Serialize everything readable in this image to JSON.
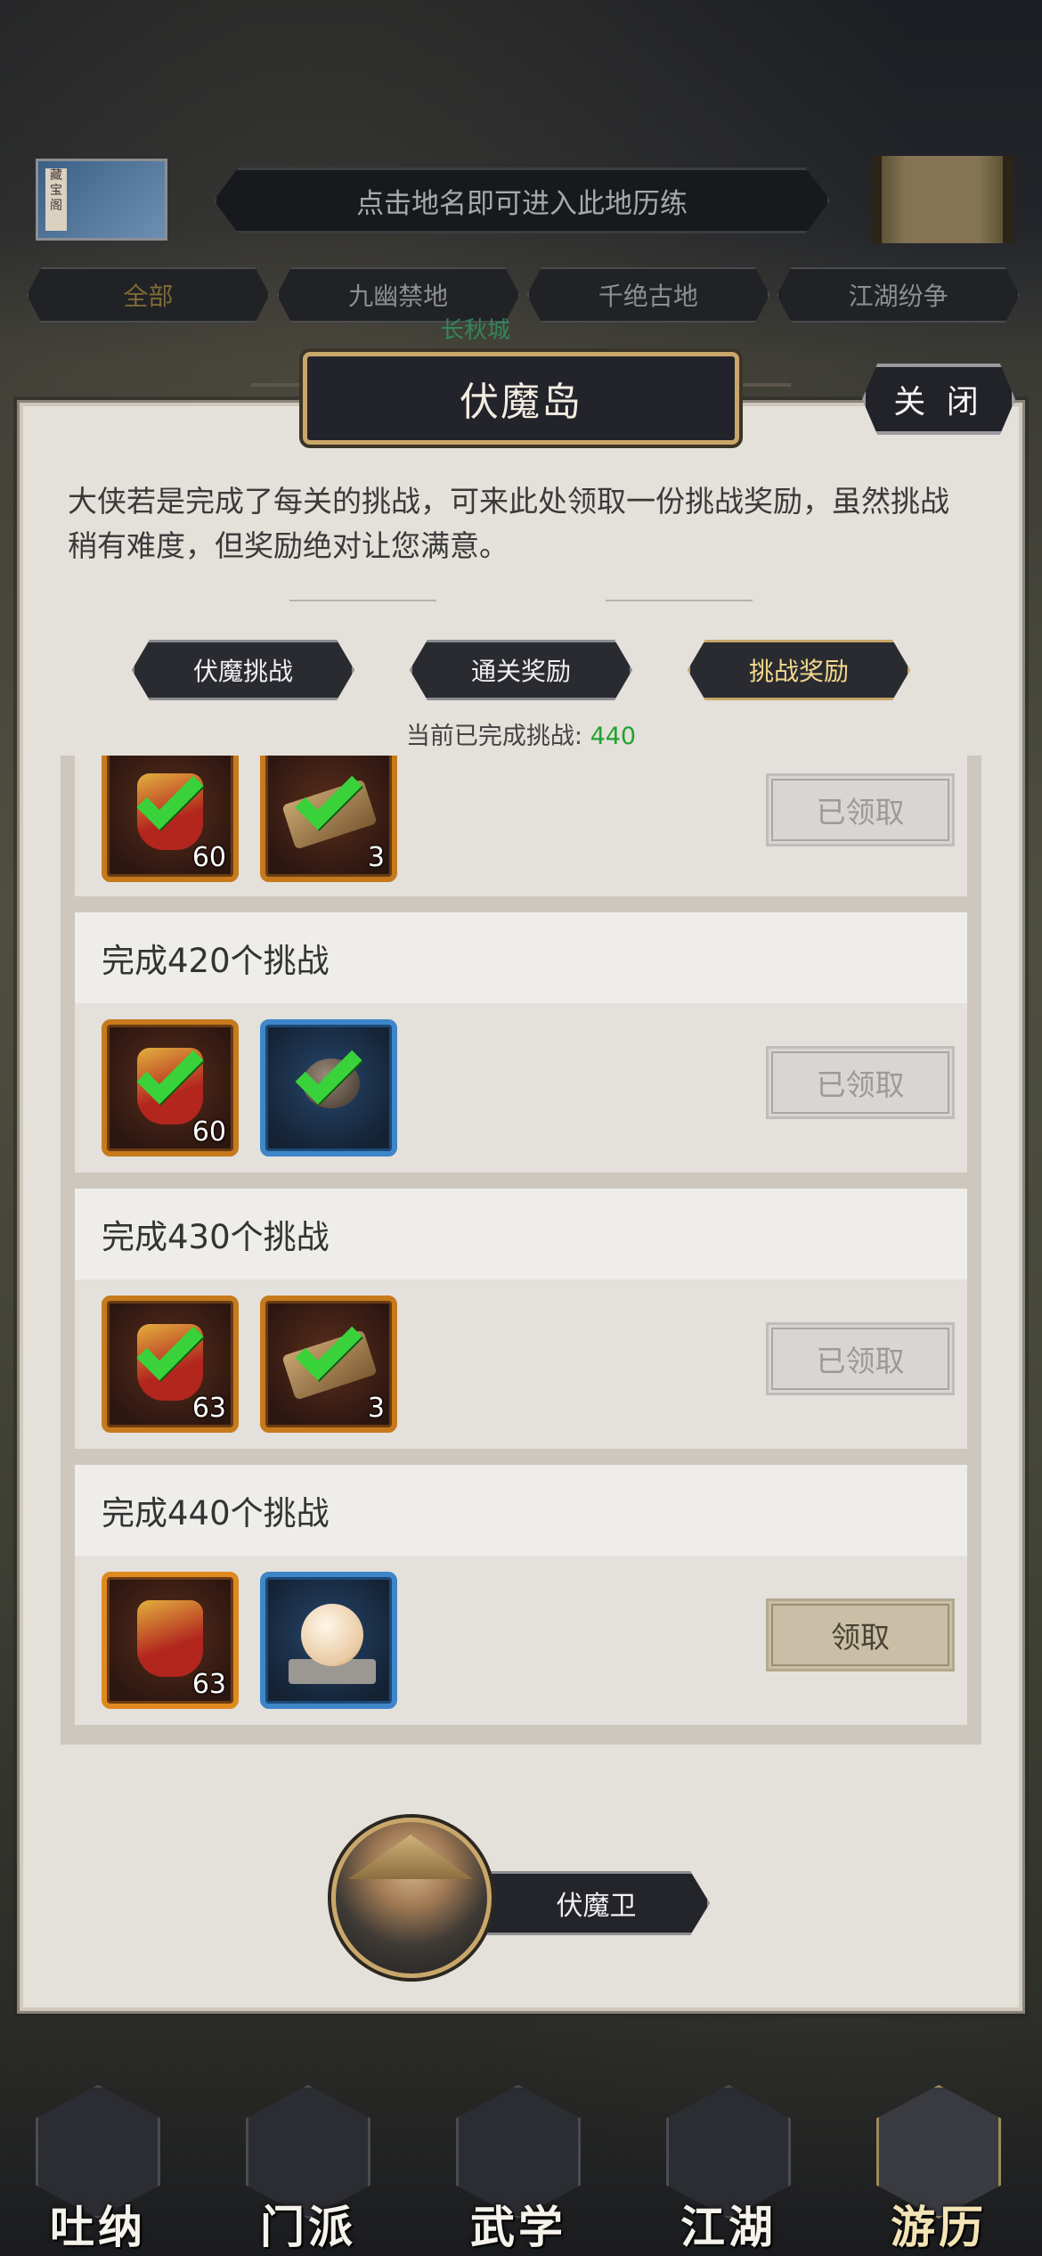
{
  "top": {
    "map_thumbnail_seal": "藏宝阁",
    "hint": "点击地名即可进入此地历练",
    "region_tabs": [
      "全部",
      "九幽禁地",
      "千绝古地",
      "江湖纷争"
    ],
    "map_label": "长秋城"
  },
  "panel": {
    "title": "伏魔岛",
    "close_label": "关 闭",
    "description": "大侠若是完成了每关的挑战，可来此处领取一份挑战奖励，虽然挑战稍有难度，但奖励绝对让您满意。",
    "tabs": [
      {
        "label": "伏魔挑战",
        "selected": false
      },
      {
        "label": "通关奖励",
        "selected": false
      },
      {
        "label": "挑战奖励",
        "selected": true
      }
    ],
    "progress_label": "当前已完成挑战:",
    "progress_value": "440"
  },
  "rewards": [
    {
      "title": "",
      "items": [
        {
          "icon": "red-token-icon",
          "count": "60",
          "claimed": true
        },
        {
          "icon": "scroll-icon",
          "count": "3",
          "claimed": true
        }
      ],
      "button_label": "已领取",
      "claimable": false
    },
    {
      "title": "完成420个挑战",
      "items": [
        {
          "icon": "red-token-icon",
          "count": "60",
          "claimed": true
        },
        {
          "icon": "stone-ball-icon",
          "count": "",
          "claimed": true
        }
      ],
      "button_label": "已领取",
      "claimable": false
    },
    {
      "title": "完成430个挑战",
      "items": [
        {
          "icon": "red-token-icon",
          "count": "63",
          "claimed": true
        },
        {
          "icon": "scroll-icon",
          "count": "3",
          "claimed": true
        }
      ],
      "button_label": "已领取",
      "claimable": false
    },
    {
      "title": "完成440个挑战",
      "items": [
        {
          "icon": "red-token-icon",
          "count": "63",
          "claimed": false
        },
        {
          "icon": "pearl-orb-icon",
          "count": "",
          "claimed": false
        }
      ],
      "button_label": "领取",
      "claimable": true
    }
  ],
  "npc": {
    "name": "伏魔卫"
  },
  "bottom_nav": [
    {
      "label": "吐纳",
      "active": false
    },
    {
      "label": "门派",
      "active": false
    },
    {
      "label": "武学",
      "active": false
    },
    {
      "label": "江湖",
      "active": false
    },
    {
      "label": "游历",
      "active": true
    }
  ],
  "colors": {
    "accent_green": "#21a22f",
    "gold_border": "#c9a76a",
    "orange_item_border": "#c67a1c",
    "blue_item_border": "#3e86c8"
  }
}
